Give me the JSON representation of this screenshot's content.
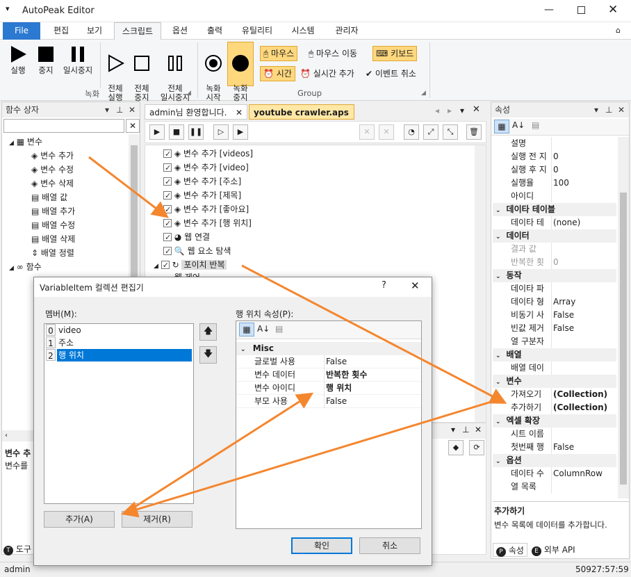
{
  "app": {
    "title": "AutoPeak Editor"
  },
  "menu": {
    "tabs": [
      "File",
      "편집",
      "보기",
      "스크립트",
      "옵션",
      "출력",
      "유틸리티",
      "시스템",
      "관리자"
    ],
    "active": "스크립트"
  },
  "ribbon": {
    "record_group": {
      "label": "녹화",
      "buttons": [
        {
          "label": "실행"
        },
        {
          "label": "중지"
        },
        {
          "label": "일시중지"
        },
        {
          "label": "전체\n실행"
        },
        {
          "label": "전체\n중지"
        },
        {
          "label": "전체\n일시중지"
        }
      ]
    },
    "group2": {
      "label": "Group",
      "buttons": [
        {
          "label": "녹화\n시작"
        },
        {
          "label": "녹화\n중지"
        }
      ],
      "chips": [
        {
          "label": "마우스",
          "active": true
        },
        {
          "label": "마우스 이동",
          "active": false
        },
        {
          "label": "키보드",
          "active": true
        },
        {
          "label": "시간",
          "active": true
        },
        {
          "label": "실시간 추가",
          "active": false
        },
        {
          "label": "이벤트 취소",
          "active": false
        }
      ]
    }
  },
  "function_box": {
    "title": "함수 상자",
    "search_value": "",
    "categories": [
      {
        "label": "변수",
        "items": [
          "변수 추가",
          "변수 수정",
          "변수 삭제",
          "배열 값",
          "배열 추가",
          "배열 수정",
          "배열 삭제",
          "배열 정렬"
        ]
      },
      {
        "label": "함수"
      }
    ],
    "bottom_title": "변수 추",
    "bottom_desc": "변수를",
    "bottom_tab": "도구"
  },
  "doc_tabs": [
    {
      "label": "admin님 환영합니다."
    },
    {
      "label": "youtube crawler.aps"
    }
  ],
  "script_lines": [
    "변수 추가 [videos]",
    "변수 추가 [video]",
    "변수 추가 [주소]",
    "변수 추가 [제목]",
    "변수 추가 [좋아요]",
    "변수 추가 [행 위치]",
    "웹 연결",
    "웹 요소 탐색",
    "포이치 반복",
    "웹 제어"
  ],
  "properties": {
    "title": "속성",
    "rows": [
      {
        "name": "설명",
        "value": ""
      },
      {
        "name": "실행 전 지",
        "value": "0"
      },
      {
        "name": "실행 후 지",
        "value": "0"
      },
      {
        "name": "실행율",
        "value": "100"
      },
      {
        "name": "아이디",
        "value": ""
      },
      {
        "cat": "데이타 테이블"
      },
      {
        "name": "데이타 테",
        "value": "(none)"
      },
      {
        "cat": "데이터"
      },
      {
        "name": "결과 값",
        "value": "",
        "dim": true
      },
      {
        "name": "반복한 횟",
        "value": "0",
        "dim": true
      },
      {
        "cat": "동작"
      },
      {
        "name": "데이타 파",
        "value": ""
      },
      {
        "name": "데이타 형",
        "value": "Array"
      },
      {
        "name": "비동기 사",
        "value": "False"
      },
      {
        "name": "빈값 제거",
        "value": "False"
      },
      {
        "name": "열 구분자",
        "value": ""
      },
      {
        "cat": "배열"
      },
      {
        "name": "배열 데이",
        "value": ""
      },
      {
        "cat": "변수"
      },
      {
        "name": "가져오기",
        "value": "(Collection)",
        "bold": true
      },
      {
        "name": "추가하기",
        "value": "(Collection)",
        "bold": true
      },
      {
        "cat": "엑셀 확장"
      },
      {
        "name": "시트 이름",
        "value": ""
      },
      {
        "name": "첫번째 행",
        "value": "False"
      },
      {
        "cat": "옵션"
      },
      {
        "name": "데이타 수",
        "value": "ColumnRow"
      },
      {
        "name": "열 목록",
        "value": ""
      }
    ],
    "desc_title": "추가하기",
    "desc_text": "변수 목록에 데이터를 추가합니다.",
    "bottom_tabs": [
      "속성",
      "외부 API"
    ]
  },
  "dialog": {
    "title": "VariableItem 컬렉션 편집기",
    "members_label": "멤버(M):",
    "members": [
      {
        "index": "0",
        "name": "video"
      },
      {
        "index": "1",
        "name": "주소"
      },
      {
        "index": "2",
        "name": "행 위치",
        "selected": true
      }
    ],
    "props_label": "행 위치 속성(P):",
    "category": "Misc",
    "props": [
      {
        "name": "글로벌 사용",
        "value": "False"
      },
      {
        "name": "변수 데이터",
        "value": "반복한 횟수",
        "bold": true
      },
      {
        "name": "변수 아이디",
        "value": "행 위치",
        "bold": true
      },
      {
        "name": "부모 사용",
        "value": "False"
      }
    ],
    "add_label": "추가(A)",
    "remove_label": "제거(R)",
    "ok_label": "확인",
    "cancel_label": "취소"
  },
  "status": {
    "user": "admin",
    "time": "50927:57:59"
  },
  "colors": {
    "accent": "#2b79d0",
    "arrow": "#f4862e",
    "chip": "#ffd87e"
  }
}
